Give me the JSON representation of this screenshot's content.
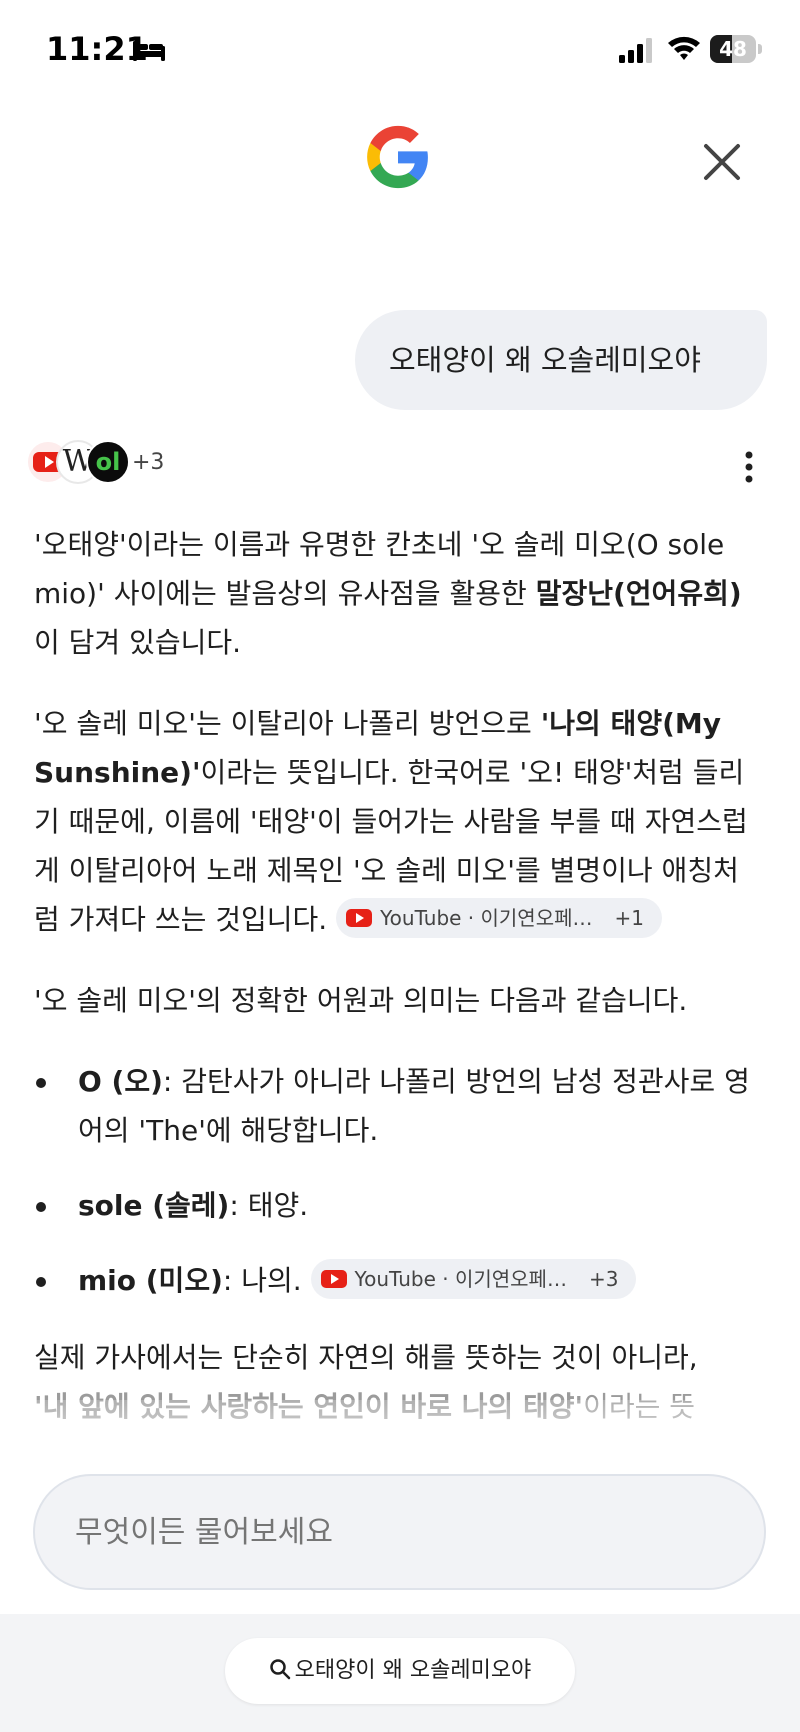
{
  "status_bar": {
    "time": "11:21",
    "battery": "48",
    "battery_level": 0.48
  },
  "header": {
    "logo": "google-g-icon",
    "close": "close-icon"
  },
  "query": {
    "text": "오태양이 왜 오솔레미오야"
  },
  "sources": {
    "icons": [
      "youtube-icon",
      "wikipedia-icon",
      "site-icon"
    ],
    "more": "+3",
    "site_letter": "ol",
    "wiki_letter": "W"
  },
  "answer": {
    "p1": {
      "a": "'오태양'이라는 이름과 유명한 칸초네 '오 솔레 미오(O sole mio)' 사이에는 발음상의 유사점을 활용한 ",
      "b": "말장난(언어유희)",
      "c": "이 담겨 있습니다."
    },
    "p2": {
      "a": "'오 솔레 미오'는 이탈리아 나폴리 방언으로 ",
      "b": "'나의 태양(My Sunshine)'",
      "c": "이라는 뜻입니다. 한국어로 '오! 태양'처럼 들리기 때문에, 이름에 '태양'이 들어가는 사람을 부를 때 자연스럽게 이탈리아어 노래 제목인 '오 솔레 미오'를 별명이나 애칭처럼 가져다 쓰는 것입니다.",
      "chip_label": "YouTube · 이기연오페…",
      "chip_count": "+1"
    },
    "p3": "'오 솔레 미오'의 정확한 어원과 의미는 다음과 같습니다.",
    "bullets": [
      {
        "term": "O (오)",
        "desc": ": 감탄사가 아니라 나폴리 방언의 남성 정관사로 영어의 'The'에 해당합니다."
      },
      {
        "term": "sole (솔레)",
        "desc": ": 태양."
      },
      {
        "term": "mio (미오)",
        "desc": ": 나의.",
        "chip_label": "YouTube · 이기연오페…",
        "chip_count": "+3"
      }
    ],
    "p4_line1": "실제 가사에서는 단순히 자연의 해를 뜻하는 것이 아니라,",
    "p4_line2_bold": "'내 앞에 있는 사랑하는 연인이 바로 나의 태양'",
    "p4_line2_rest": "이라는 뜻"
  },
  "ask": {
    "placeholder": "무엇이든 물어보세요"
  },
  "bottom": {
    "search_label": "오태양이 왜 오솔레미오야"
  },
  "colors": {
    "bubble": "#eef0f4",
    "youtube_red": "#e62117",
    "text": "#1f1f1f"
  }
}
